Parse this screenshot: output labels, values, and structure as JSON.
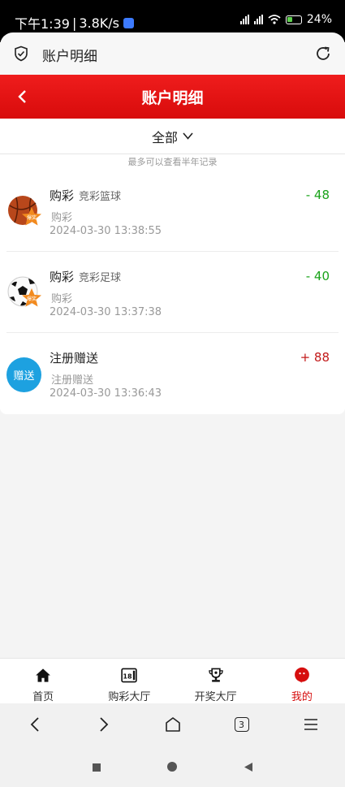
{
  "status_bar": {
    "time": "下午1:39",
    "speed": "3.8K/s",
    "battery": "24%"
  },
  "browser": {
    "page_title": "账户明细"
  },
  "header": {
    "title": "账户明细"
  },
  "filter": {
    "label": "全部",
    "note": "最多可以查看半年记录"
  },
  "records": [
    {
      "title": "购彩",
      "subtitle": "竞彩篮球",
      "desc": "购彩",
      "time": "2024-03-30 13:38:55",
      "amount": "- 48",
      "icon": "basketball-icon"
    },
    {
      "title": "购彩",
      "subtitle": "竞彩足球",
      "desc": "购彩",
      "time": "2024-03-30 13:37:38",
      "amount": "- 40",
      "icon": "football-icon"
    },
    {
      "title": "注册赠送",
      "subtitle": "",
      "desc": "注册赠送",
      "time": "2024-03-30 13:36:43",
      "amount": "+ 88",
      "icon": "gift-icon",
      "icon_text": "赠送"
    }
  ],
  "badge_text": "爆奖",
  "tabs": [
    {
      "label": "首页",
      "icon": "home-icon"
    },
    {
      "label": "购彩大厅",
      "icon": "calendar-18-icon"
    },
    {
      "label": "开奖大厅",
      "icon": "trophy-icon"
    },
    {
      "label": "我的",
      "icon": "profile-icon"
    }
  ],
  "browser_nav": {
    "tabs_count": "3"
  },
  "colors": {
    "brand_red": "#d80b0b",
    "debit_green": "#1aa31a",
    "credit_red": "#c21a1a",
    "gift_blue": "#1da1e0"
  }
}
